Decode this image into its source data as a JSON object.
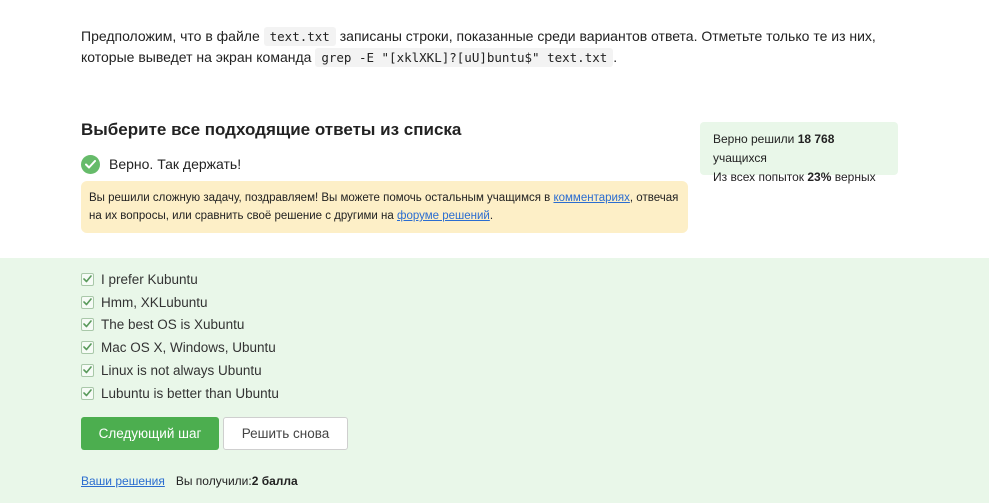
{
  "question": {
    "p1": "Предположим, что в файле ",
    "file_code": "text.txt",
    "p2": " записаны строки, показанные среди вариантов ответа. Отметьте только те из них, которые выведет на экран команда ",
    "cmd_code": "grep -E \"[xklXKL]?[uU]buntu$\" text.txt",
    "p3": "."
  },
  "section_title": "Выберите все подходящие ответы из списка",
  "stats": {
    "line1_prefix": "Верно решили ",
    "solved_count": "18 768",
    "line1_suffix": " учащихся",
    "line2_prefix": "Из всех попыток ",
    "percent": "23%",
    "line2_suffix": " верных"
  },
  "result": {
    "text": "Верно. Так держать!",
    "icon": "checkmark-circle-icon",
    "color": "#66bb6a"
  },
  "notice": {
    "t1": "Вы решили сложную задачу, поздравляем! Вы можете помочь остальным учащимся в ",
    "link1": "комментариях",
    "t2": ", отвечая на их вопросы, или сравнить своё решение с другими на ",
    "link2": "форуме решений",
    "t3": "."
  },
  "options": [
    {
      "label": "I prefer Kubuntu",
      "checked": true
    },
    {
      "label": "Hmm, XKLubuntu",
      "checked": true
    },
    {
      "label": "The best OS is Xubuntu",
      "checked": true
    },
    {
      "label": "Mac OS X, Windows, Ubuntu",
      "checked": true
    },
    {
      "label": "Linux is not always Ubuntu",
      "checked": true
    },
    {
      "label": "Lubuntu is better than Ubuntu",
      "checked": true
    }
  ],
  "buttons": {
    "next": "Следующий шаг",
    "retry": "Решить снова"
  },
  "footer": {
    "solutions_link": "Ваши решения",
    "received_label": "Вы получили: ",
    "score": "2 балла"
  },
  "colors": {
    "accent_green": "#4cae4f",
    "answers_bg": "#e9f7e9",
    "notice_bg": "#fdefc7",
    "link": "#2b6dd0"
  }
}
